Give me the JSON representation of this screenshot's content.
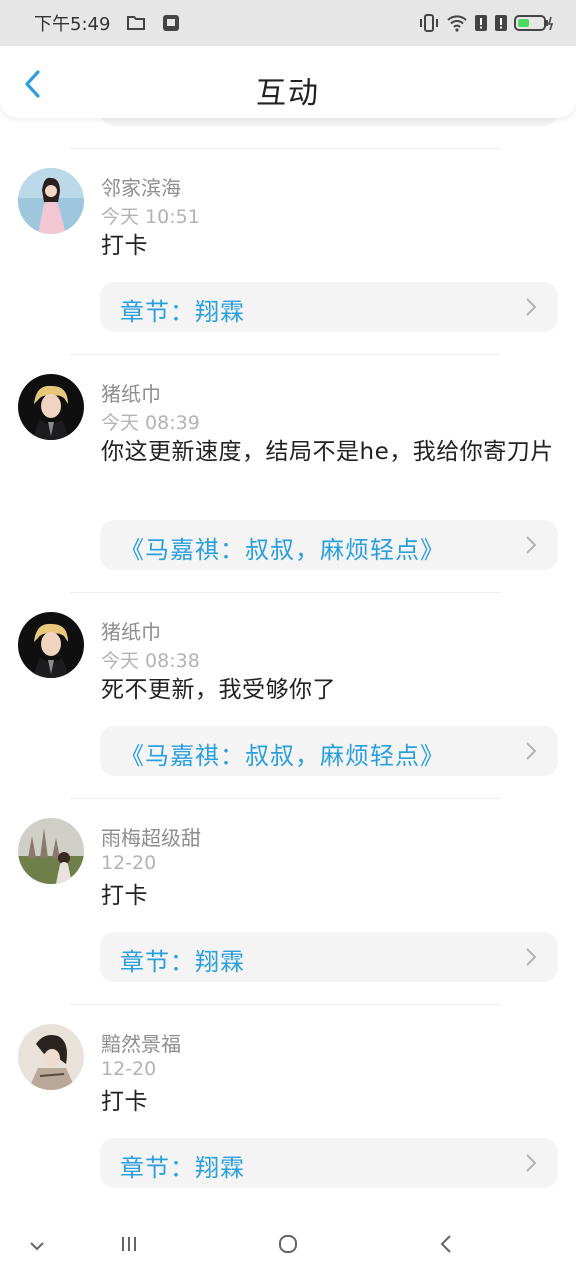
{
  "status_bar": {
    "time": "下午5:49",
    "icons": [
      "folder-icon",
      "sim-card-icon",
      "vibrate-icon",
      "wifi-icon",
      "signal-alert-icon",
      "signal-alert-icon",
      "battery-charging-icon"
    ]
  },
  "header": {
    "title": "互动",
    "back_icon": "chevron-left-icon"
  },
  "colors": {
    "accent": "#2a9fdd",
    "card_bg": "#f4f4f5",
    "status_bar_bg": "#e6e6e6",
    "battery_green": "#4cd964"
  },
  "feed": [
    {
      "user": "邻家滨海",
      "time": "今天 10:51",
      "comment": "打卡",
      "chapter": "章节：翔霖",
      "avatar": "avatar-girl-pink-dress"
    },
    {
      "user": "猪纸巾",
      "time": "今天 08:39",
      "comment": "你这更新速度，结局不是he，我给你寄刀片",
      "chapter": "《马嘉祺：叔叔，麻烦轻点》",
      "avatar": "avatar-blond-boy"
    },
    {
      "user": "猪纸巾",
      "time": "今天 08:38",
      "comment": "死不更新，我受够你了",
      "chapter": "《马嘉祺：叔叔，麻烦轻点》",
      "avatar": "avatar-blond-boy"
    },
    {
      "user": "雨梅超级甜",
      "time": "12-20",
      "comment": "打卡",
      "chapter": "章节：翔霖",
      "avatar": "avatar-castle-girl"
    },
    {
      "user": "黯然景福",
      "time": "12-20",
      "comment": "打卡",
      "chapter": "章节：翔霖",
      "avatar": "avatar-dark-hair-girl"
    }
  ],
  "nav_bar": {
    "buttons": [
      "chevron-down-icon",
      "recent-apps-icon",
      "home-icon",
      "back-icon"
    ]
  }
}
